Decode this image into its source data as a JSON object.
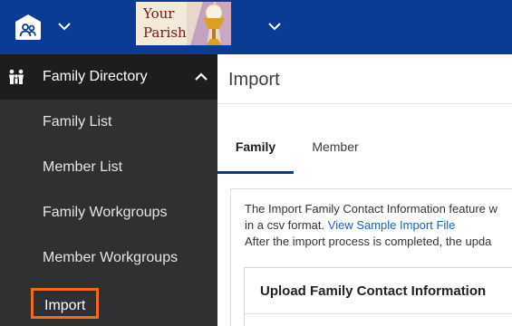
{
  "topbar": {
    "home_icon": "house-people-icon",
    "menu_icon": "chevron-down-icon",
    "logo_lines": [
      "Your",
      "Parish"
    ],
    "parish_menu_icon": "chevron-down-icon",
    "background_color": "#0a3c96"
  },
  "sidebar": {
    "section": {
      "label": "Family Directory",
      "icon": "family-icon",
      "collapse_icon": "chevron-up-icon",
      "expanded": true
    },
    "items": [
      {
        "label": "Family List"
      },
      {
        "label": "Member List"
      },
      {
        "label": "Family Workgroups"
      },
      {
        "label": "Member Workgroups"
      },
      {
        "label": "Import",
        "active": true
      }
    ],
    "highlight_color": "#ef6c1a"
  },
  "main": {
    "title": "Import",
    "tabs": [
      {
        "label": "Family",
        "selected": true
      },
      {
        "label": "Member",
        "selected": false
      }
    ],
    "info": {
      "line1": "The Import Family Contact Information feature w",
      "line2_text": "in a csv format.",
      "line2_link": "View Sample Import File",
      "line3": "After the import process is completed, the upda"
    },
    "upload_card": {
      "title": "Upload Family Contact Information"
    }
  }
}
